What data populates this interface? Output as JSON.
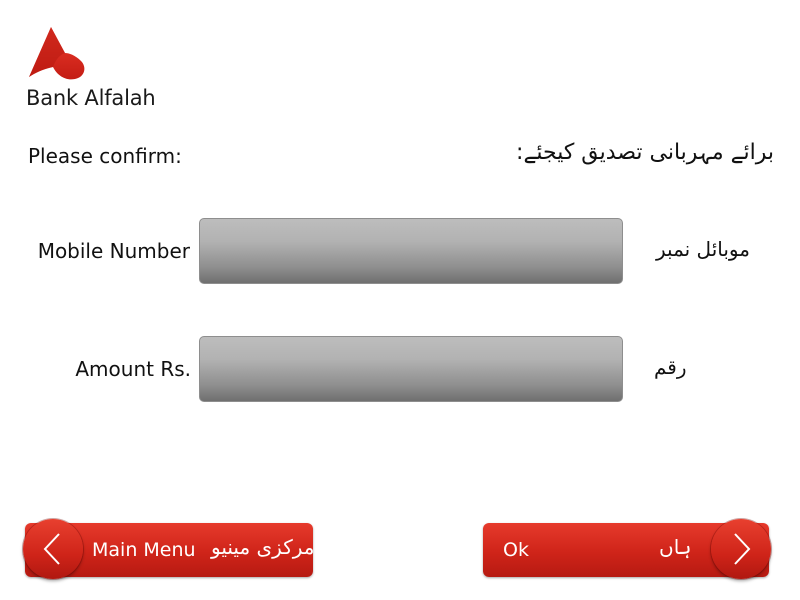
{
  "brand": {
    "name": "Bank Alfalah",
    "logo_color": "#d7261c"
  },
  "prompt": {
    "confirm_en": "Please confirm:",
    "confirm_ur": "برائے مہربانی تصدیق کیجئے:"
  },
  "fields": [
    {
      "label_en": "Mobile Number",
      "label_ur": "موبائل نمبر",
      "value": ""
    },
    {
      "label_en": "Amount Rs.",
      "label_ur": "رقم",
      "value": ""
    }
  ],
  "buttons": {
    "main_menu": {
      "label_en": "Main Menu",
      "label_ur": "مرکزی مینیو",
      "icon": "chevron-left-icon"
    },
    "ok": {
      "label_en": "Ok",
      "label_ur": "ہاں",
      "icon": "chevron-right-icon"
    }
  },
  "colors": {
    "button_red": "#cf2419",
    "field_gray": "#a8a8a8",
    "text": "#111111",
    "background": "#ffffff"
  }
}
